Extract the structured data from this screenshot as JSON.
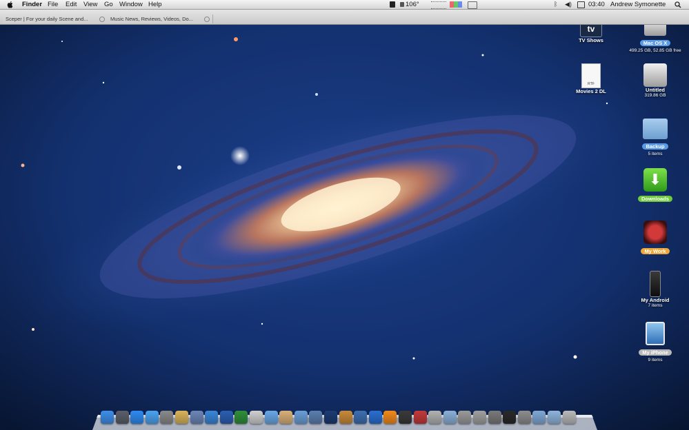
{
  "menubar": {
    "app_name": "Finder",
    "menus": [
      "File",
      "Edit",
      "View",
      "Go",
      "Window",
      "Help"
    ],
    "status": {
      "temperature": "106°",
      "time": "03:40",
      "user": "Andrew Symonette"
    }
  },
  "browser_tabs": [
    {
      "label": "Sceper | For your daily Scene and..."
    },
    {
      "label": "Music News, Reviews, Videos, Do..."
    }
  ],
  "desktop_icons": [
    {
      "label": "TV Shows",
      "sub": "",
      "icon": "tv-shows-icon"
    },
    {
      "label": "Mac OS X",
      "sub": "499.25 GB, 52.85 GB free",
      "icon": "hard-drive-icon",
      "label_color": "#5b9be6"
    },
    {
      "label": "Movies 2 DL",
      "sub": "",
      "icon": "rtf-document-icon"
    },
    {
      "label": "Untitled",
      "sub": "319.86 GB",
      "icon": "hard-drive-icon"
    },
    {
      "label": "Backup",
      "sub": "5 items",
      "icon": "folder-icon",
      "label_color": "#5b9be6"
    },
    {
      "label": "Downloads",
      "sub": "",
      "icon": "downloads-icon",
      "label_color": "#6fcb3b"
    },
    {
      "label": "My Work",
      "sub": "",
      "icon": "my-work-icon",
      "label_color": "#f0a83a"
    },
    {
      "label": "My Android",
      "sub": "7 items",
      "icon": "android-phone-icon"
    },
    {
      "label": "My iPhone",
      "sub": "9 items",
      "icon": "iphone-icon",
      "label_color": "#b8b8b8"
    }
  ],
  "dock": {
    "items": [
      {
        "icon": "finder-icon",
        "color": "#3e8ee8"
      },
      {
        "icon": "launchpad-icon",
        "color": "#5a5f6a"
      },
      {
        "icon": "app-store-icon",
        "color": "#2f8bf0"
      },
      {
        "icon": "messages-icon",
        "color": "#4aa3f0"
      },
      {
        "icon": "script-editor-icon",
        "color": "#8a8a8a"
      },
      {
        "icon": "notes-icon",
        "color": "#d9b35a"
      },
      {
        "icon": "preview-icon",
        "color": "#6c86b8"
      },
      {
        "icon": "safari-icon",
        "color": "#3a86d8"
      },
      {
        "icon": "word-icon",
        "color": "#2b5fb3"
      },
      {
        "icon": "excel-icon",
        "color": "#2f8f3a"
      },
      {
        "icon": "ipod-icon",
        "color": "#cfcfcf"
      },
      {
        "icon": "mail-icon",
        "color": "#6aa7e6"
      },
      {
        "icon": "address-book-icon",
        "color": "#d8b078"
      },
      {
        "icon": "itunes-icon",
        "color": "#6a9ed8"
      },
      {
        "icon": "iphoto-icon",
        "color": "#5b7fb0"
      },
      {
        "icon": "photoshop-icon",
        "color": "#1d3c73"
      },
      {
        "icon": "image-capture-icon",
        "color": "#c88a3a"
      },
      {
        "icon": "quicktime-icon",
        "color": "#3d6fb0"
      },
      {
        "icon": "q-app-icon",
        "color": "#2a6fd0"
      },
      {
        "icon": "vlc-icon",
        "color": "#f08a1c"
      },
      {
        "icon": "final-cut-icon",
        "color": "#3a3a3a"
      },
      {
        "icon": "clapboard-icon",
        "color": "#c23a3a"
      },
      {
        "icon": "dvd-player-icon",
        "color": "#b2b2b2"
      },
      {
        "icon": "utility-icon",
        "color": "#8ab0d8"
      },
      {
        "icon": "preferences-icon",
        "color": "#9a9a9a"
      },
      {
        "icon": "disk-utility-icon",
        "color": "#a0a0a0"
      },
      {
        "icon": "printer-icon",
        "color": "#7a7a7a"
      },
      {
        "icon": "activity-monitor-icon",
        "color": "#2a2a2a"
      },
      {
        "icon": "system-preferences-icon",
        "color": "#8d8d8d"
      },
      {
        "icon": "applications-folder-icon",
        "color": "#7fa8d6"
      },
      {
        "icon": "documents-folder-icon",
        "color": "#8fb4dc"
      },
      {
        "icon": "trash-icon",
        "color": "#b9b9b9"
      }
    ]
  }
}
